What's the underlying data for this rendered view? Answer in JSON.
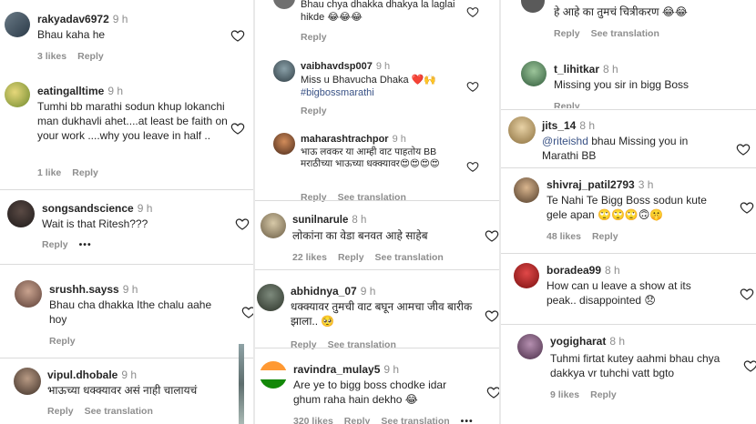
{
  "left": [
    {
      "user": "rakyadav6972",
      "time": "9 h",
      "text": "Bhau kaha he",
      "likes": "3 likes",
      "reply": "Reply"
    },
    {
      "user": "eatingalltime",
      "time": "9 h",
      "text": "Tumhi bb marathi sodun khup lokanchi man dukhavli ahet....at least be faith on your work ....why you leave in half ..",
      "likes": "1 like",
      "reply": "Reply"
    },
    {
      "user": "songsandscience",
      "time": "9 h",
      "text": "Wait is that Ritesh???",
      "reply": "Reply"
    },
    {
      "user": "srushh.sayss",
      "time": "9 h",
      "text": "Bhau cha dhakka Ithe chalu aahe hoy",
      "reply": "Reply"
    },
    {
      "user": "vipul.dhobale",
      "time": "9 h",
      "text": "भाऊच्या धक्क्यावर असं नाही चालायचं",
      "reply": "Reply",
      "see_translation": "See translation"
    }
  ],
  "middle": [
    {
      "text": "Bhau chya dhakka dhakya la laglai hikde 😂😂😂",
      "reply": "Reply"
    },
    {
      "user": "vaibhavdsp007",
      "time": "9 h",
      "text": "Miss u Bhavucha Dhaka ❤️🙌",
      "tag": "#bigbossmarathi",
      "reply": "Reply"
    },
    {
      "user": "maharashtrachpor",
      "time": "9 h",
      "text": "भाऊ लवकर या आम्ही वाट पाहतोय BB मराठीच्या भाऊच्या धक्क्यावर😍😍😍😍",
      "reply": "Reply",
      "see_translation": "See translation"
    },
    {
      "user": "sunilnarule",
      "time": "8 h",
      "text": "लोकांना का वेडा बनवत आहे साहेब",
      "likes": "22 likes",
      "reply": "Reply",
      "see_translation": "See translation"
    },
    {
      "user": "abhidnya_07",
      "time": "9 h",
      "text": "धक्क्यावर तुमची वाट बघून आमचा जीव बारीक झाला.. 🥺",
      "reply": "Reply",
      "see_translation": "See translation"
    },
    {
      "user": "ravindra_mulay5",
      "time": "9 h",
      "text": "Are ye to bigg boss chodke idar ghum raha hain dekho 😂",
      "likes": "320 likes",
      "reply": "Reply",
      "see_translation": "See translation"
    }
  ],
  "right": [
    {
      "text": "हे आहे का तुमचं चित्रीकरण 😂😂",
      "reply": "Reply",
      "see_translation": "See translation"
    },
    {
      "user": "t_lihitkar",
      "time": "8 h",
      "text": "Missing you sir in bigg Boss",
      "reply": "Reply"
    },
    {
      "user": "jits_14",
      "time": "8 h",
      "mention": "@riteishd",
      "text": "bhau Missing you in Marathi BB"
    },
    {
      "user": "shivraj_patil2793",
      "time": "3 h",
      "text": "Te Nahi Te Bigg Boss sodun kute gele apan 🙄🙄🙄🙃🤫",
      "likes": "48 likes",
      "reply": "Reply"
    },
    {
      "user": "boradea99",
      "time": "8 h",
      "text": "How can u leave a show at its peak.. disappointed 😞"
    },
    {
      "user": "yogigharat",
      "time": "8 h",
      "text": "Tuhmi firtat kutey aahmi bhau chya dakkya vr tuhchi vatt bgto",
      "likes": "9 likes",
      "reply": "Reply"
    }
  ],
  "colors": {
    "text": "#262626",
    "muted": "#8e8e8e",
    "link": "#385185",
    "heart_stroke": "#262626",
    "background": "#e9e9e9"
  }
}
